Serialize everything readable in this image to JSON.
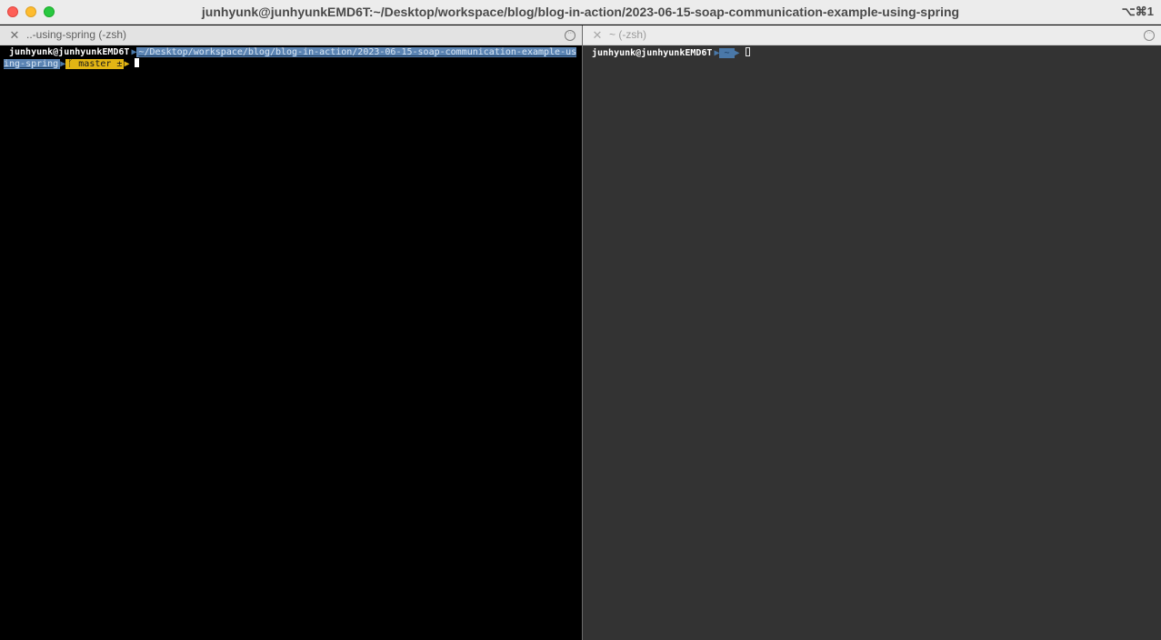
{
  "window": {
    "title": "junhyunk@junhyunkEMD6T:~/Desktop/workspace/blog/blog-in-action/2023-06-15-soap-communication-example-using-spring",
    "shortcut": "⌥⌘1"
  },
  "panes": {
    "left": {
      "tab_title": "..-using-spring (-zsh)",
      "prompt_user": "junhyunk@junhyunkEMD6T",
      "prompt_path": "~/Desktop/workspace/blog/blog-in-action/2023-06-15-soap-communication-example-using-spring",
      "git_branch": "master ±",
      "git_icon": "branch-icon"
    },
    "right": {
      "tab_title": "~ (-zsh)",
      "prompt_user": "junhyunk@junhyunkEMD6T",
      "prompt_path": "~"
    }
  },
  "colors": {
    "path_segment": "#4a78a8",
    "git_segment": "#e2b514",
    "left_background": "#000000",
    "right_background": "#333333"
  },
  "icons": {
    "tab_close": "close-icon",
    "tab_menu": "more-icon",
    "powerline_separator": "chevron-right-icon"
  }
}
